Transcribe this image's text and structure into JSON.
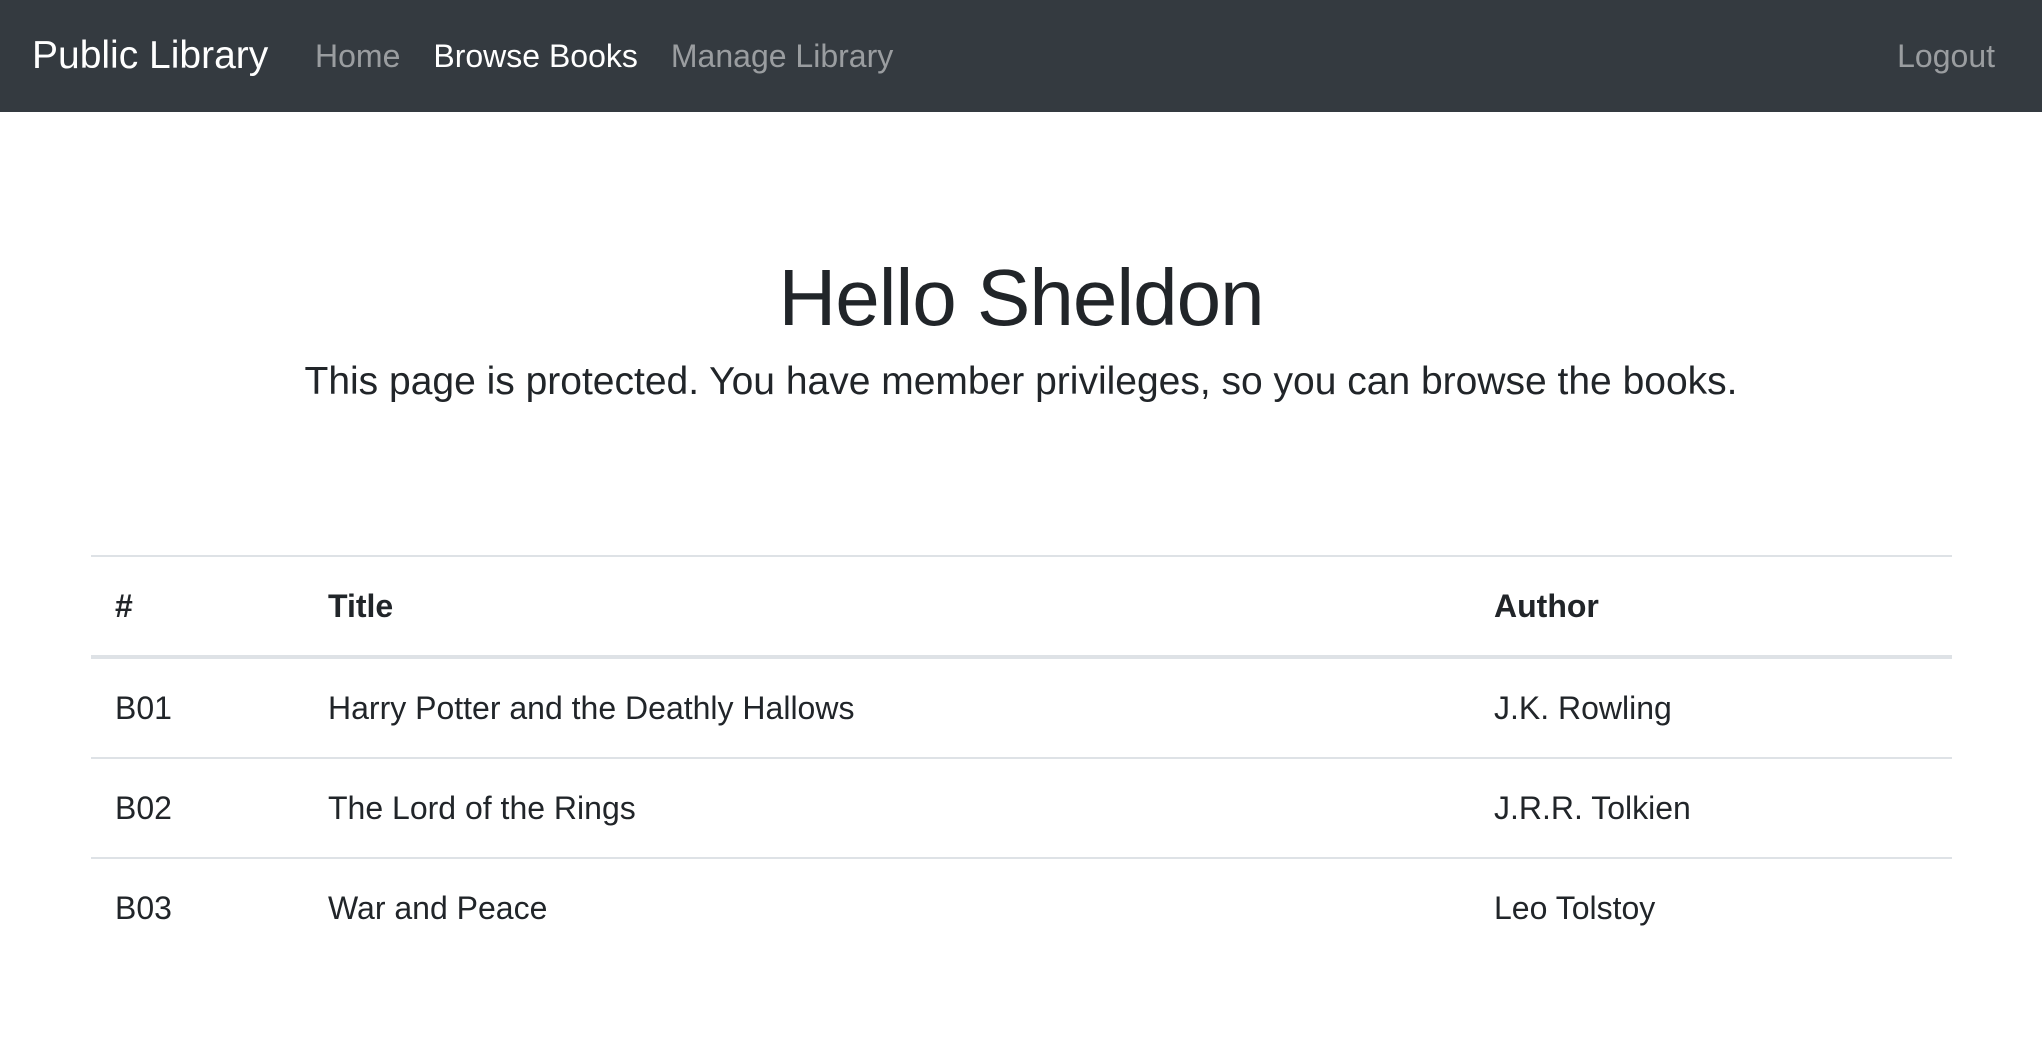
{
  "navbar": {
    "brand": "Public Library",
    "links": [
      {
        "label": "Home",
        "active": false
      },
      {
        "label": "Browse Books",
        "active": true
      },
      {
        "label": "Manage Library",
        "active": false
      }
    ],
    "logout_label": "Logout"
  },
  "hero": {
    "title": "Hello Sheldon",
    "subtitle": "This page is protected. You have member privileges, so you can browse the books."
  },
  "table": {
    "headers": [
      "#",
      "Title",
      "Author"
    ],
    "rows": [
      [
        "B01",
        "Harry Potter and the Deathly Hallows",
        "J.K. Rowling"
      ],
      [
        "B02",
        "The Lord of the Rings",
        "J.R.R. Tolkien"
      ],
      [
        "B03",
        "War and Peace",
        "Leo Tolstoy"
      ]
    ]
  },
  "colors": {
    "navbar_bg": "#343a40",
    "text": "#212529",
    "border": "#dee2e6"
  }
}
